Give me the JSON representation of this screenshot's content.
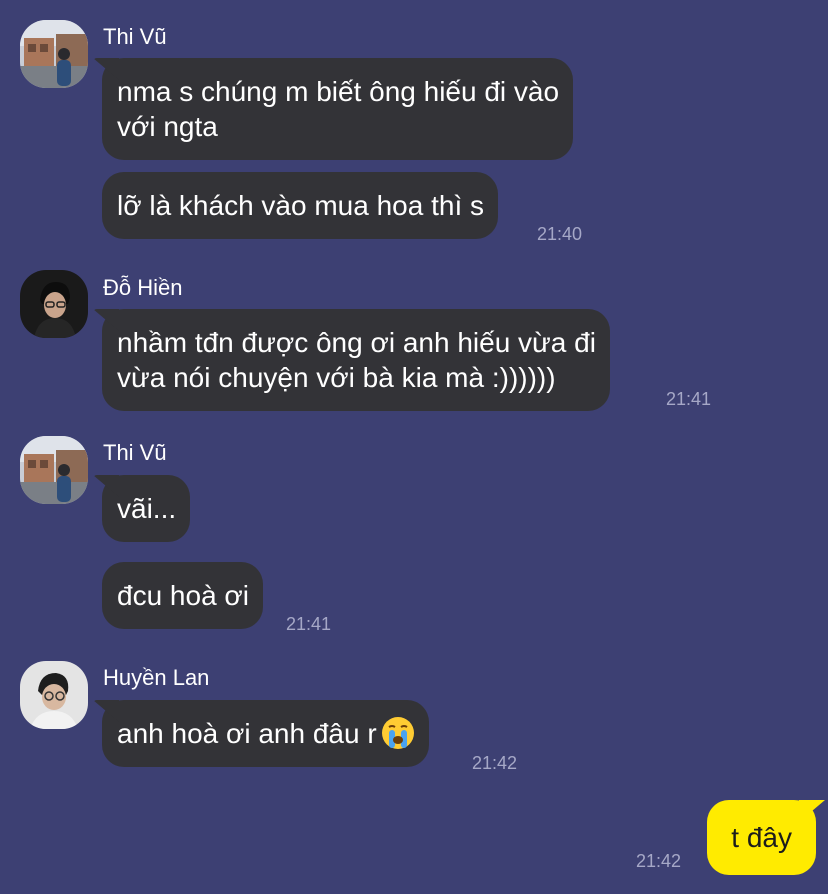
{
  "messages": [
    {
      "sender": "Thi Vũ",
      "bubbles": [
        "nma s chúng m biết ông hiếu đi vào\nvới ngta",
        "lỡ là khách vào mua hoa thì s"
      ],
      "time": "21:40"
    },
    {
      "sender": "Đỗ Hiền",
      "bubbles": [
        "nhầm tđn được ông ơi anh hiếu vừa đi\nvừa nói chuyện với bà kia mà :))))))"
      ],
      "time": "21:41"
    },
    {
      "sender": "Thi Vũ",
      "bubbles": [
        "vãi...",
        "đcu hoà ơi"
      ],
      "time": "21:41"
    },
    {
      "sender": "Huyền Lan",
      "bubbles": [
        "anh hoà ơi anh đâu r"
      ],
      "emoji": "crying-face-icon",
      "time": "21:42"
    }
  ],
  "mine": {
    "text": "t đây",
    "time": "21:42"
  },
  "colors": {
    "background": "#3d4073",
    "bubble": "#333337",
    "mine_bubble": "#ffeb00",
    "time": "#a6a8c7"
  }
}
